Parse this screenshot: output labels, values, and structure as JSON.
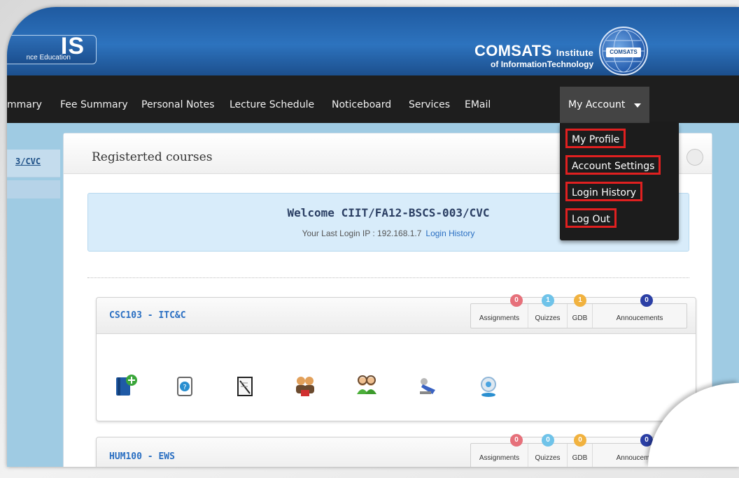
{
  "banner": {
    "logo_text": "IS",
    "logo_subtext": "nce Education",
    "institute_name": "COMSATS",
    "institute_word": "Institute",
    "institute_sub": "of InformationTechnology",
    "emblem_label": "COMSATS"
  },
  "nav": {
    "items": [
      "mmary",
      "Fee Summary",
      "Personal Notes",
      "Lecture Schedule",
      "Noticeboard",
      "Services",
      "EMail"
    ],
    "account_label": "My Account"
  },
  "dropdown": {
    "items": [
      "My Profile",
      "Account Settings",
      "Login History",
      "Log Out"
    ]
  },
  "sidebar": {
    "id_fragment": "3/CVC"
  },
  "panel": {
    "title": "Registerted courses",
    "welcome_title": "Welcome CIIT/FA12-BSCS-003/CVC",
    "last_login_label": "Your Last Login IP : 192.168.1.7",
    "login_history_link": "Login History"
  },
  "courses": [
    {
      "title": "CSC103 - ITC&C",
      "stats": [
        {
          "label": "Assignments",
          "count": "0",
          "color": "#e6707a"
        },
        {
          "label": "Quizzes",
          "count": "1",
          "color": "#6fc3e9"
        },
        {
          "label": "GDB",
          "count": "1",
          "color": "#f1b23f"
        },
        {
          "label": "Annoucements",
          "count": "0",
          "color": "#2b3fa5"
        }
      ],
      "tools": [
        "book-add-icon",
        "help-icon",
        "notes-icon",
        "group-icon",
        "users-icon",
        "speaker-icon",
        "webcam-icon"
      ]
    },
    {
      "title": "HUM100 - EWS",
      "stats": [
        {
          "label": "Assignments",
          "count": "0",
          "color": "#e6707a"
        },
        {
          "label": "Quizzes",
          "count": "0",
          "color": "#6fc3e9"
        },
        {
          "label": "GDB",
          "count": "0",
          "color": "#f1b23f"
        },
        {
          "label": "Annoucements",
          "count": "0",
          "color": "#2b3fa5"
        }
      ]
    }
  ]
}
